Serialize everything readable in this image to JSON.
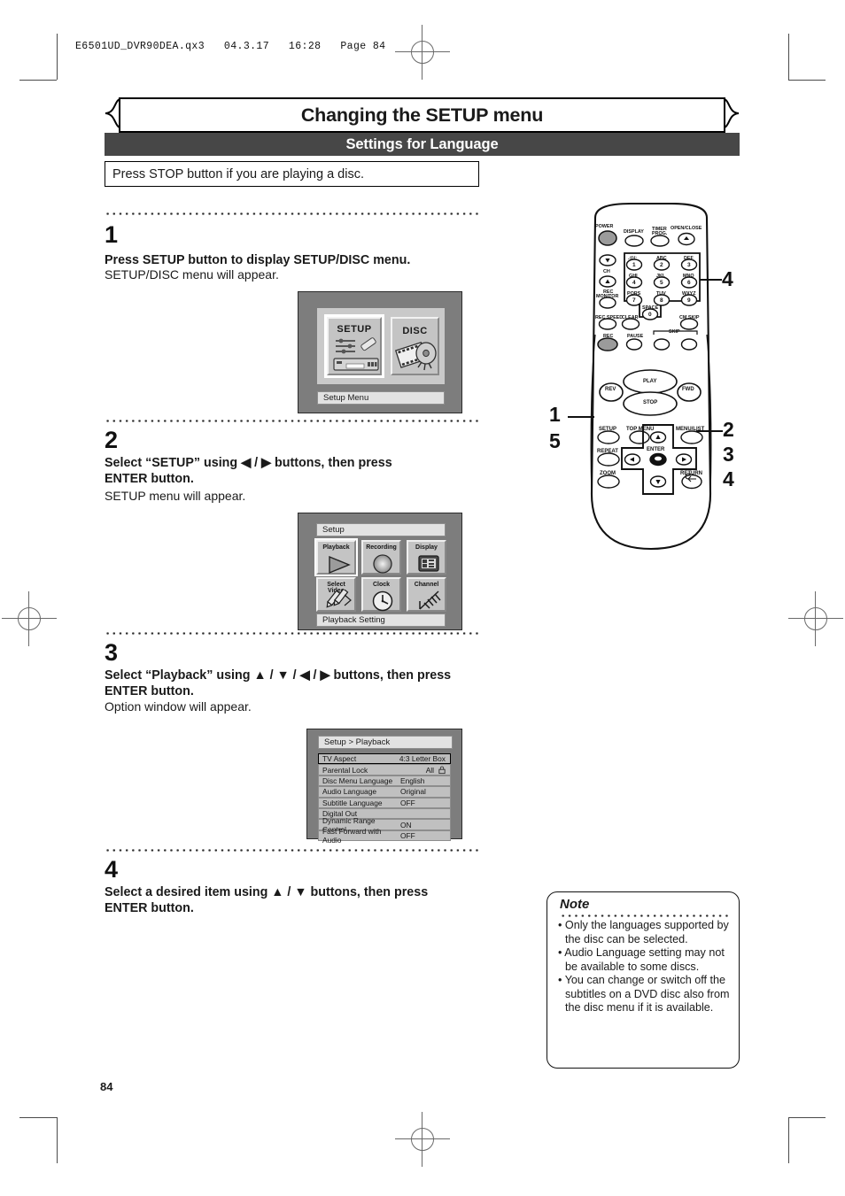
{
  "file_header": "E6501UD_DVR90DEA.qx3   04.3.17   16:28   Page 84",
  "page_number": "84",
  "header": {
    "title": "Changing the SETUP menu",
    "subtitle": "Settings for Language",
    "precaution": "Press STOP button if you are playing a disc."
  },
  "steps": [
    {
      "num": "1",
      "head": "Press SETUP button to display SETUP/DISC menu.",
      "sub": "SETUP/DISC menu will appear."
    },
    {
      "num": "2",
      "head_line1": "Select “SETUP” using ◀ / ▶ buttons, then press",
      "head_line2": "ENTER button.",
      "sub": "SETUP menu will appear."
    },
    {
      "num": "3",
      "head_line1": "Select “Playback” using ▲ / ▼ / ◀ / ▶ buttons, then press",
      "head_line2": "ENTER button.",
      "sub": "Option window will appear."
    },
    {
      "num": "4",
      "head_line1": "Select a desired item using ▲ / ▼ buttons, then press",
      "head_line2": "ENTER button."
    }
  ],
  "screen1": {
    "tiles": [
      {
        "label": "SETUP",
        "selected": true
      },
      {
        "label": "DISC",
        "selected": false
      }
    ],
    "status": "Setup Menu"
  },
  "screen2": {
    "title": "Setup",
    "tiles": [
      {
        "label": "Playback",
        "selected": true
      },
      {
        "label": "Recording",
        "selected": false
      },
      {
        "label": "Display",
        "selected": false
      },
      {
        "label": "Select\nVideo",
        "selected": false
      },
      {
        "label": "Clock",
        "selected": false
      },
      {
        "label": "Channel",
        "selected": false
      }
    ],
    "status": "Playback Setting"
  },
  "screen3": {
    "title": "Setup > Playback",
    "rows": [
      {
        "label": "TV Aspect",
        "value": "4:3 Letter Box",
        "highlight": true
      },
      {
        "label": "Parental Lock",
        "value": "All",
        "icon": "lock-icon"
      },
      {
        "label": "Disc Menu Language",
        "value": "English"
      },
      {
        "label": "Audio Language",
        "value": "Original"
      },
      {
        "label": "Subtitle Language",
        "value": "OFF"
      },
      {
        "label": "Digital Out",
        "value": ""
      },
      {
        "label": "Dynamic Range Control",
        "value": "ON"
      },
      {
        "label": "Fast Forward with Audio",
        "value": "OFF"
      }
    ]
  },
  "note": {
    "title": "Note",
    "items": [
      "Only the languages supported by the disc can be selected.",
      "Audio Language setting may not be available to some discs.",
      "You can change or switch off the subtitles on a DVD disc also from the disc menu if it is available."
    ]
  },
  "remote": {
    "labels": {
      "power": "POWER",
      "display": "DISPLAY",
      "timer_prog_1": "TIMER",
      "timer_prog_2": "PROG.",
      "open_close": "OPEN/CLOSE",
      "ch": "CH",
      "rec_monitor_1": "REC",
      "rec_monitor_2": "MONITOR",
      "rec_speed": "REC SPEED",
      "clear": "CLEAR",
      "space": "SPACE",
      "cm_skip": "CM SKIP",
      "rec": "REC",
      "pause": "PAUSE",
      "skip": "SKIP",
      "play": "PLAY",
      "stop": "STOP",
      "rev": "REV",
      "fwd": "FWD",
      "setup": "SETUP",
      "top_menu": "TOP MENU",
      "menu_list": "MENU/LIST",
      "repeat": "REPEAT",
      "enter": "ENTER",
      "zoom": "ZOOM",
      "return": "RETURN"
    },
    "keypad": [
      {
        "letters": ".@/:",
        "digit": "1"
      },
      {
        "letters": "ABC",
        "digit": "2"
      },
      {
        "letters": "DEF",
        "digit": "3"
      },
      {
        "letters": "GHI",
        "digit": "4"
      },
      {
        "letters": "JKL",
        "digit": "5"
      },
      {
        "letters": "MNO",
        "digit": "6"
      },
      {
        "letters": "PQRS",
        "digit": "7"
      },
      {
        "letters": "TUV",
        "digit": "8"
      },
      {
        "letters": "WXYZ",
        "digit": "9"
      },
      {
        "letters": "",
        "digit": "0"
      }
    ],
    "callouts": {
      "keypad": "4",
      "setup_a": "1",
      "setup_b": "5",
      "pad_a": "2",
      "pad_b": "3",
      "pad_c": "4"
    }
  },
  "colors": {
    "subbar_bg": "#474747",
    "tv_bezel": "#7d7d7d",
    "tv_field": "#c9c9c9",
    "tile": "#c4c4c4",
    "row": "#c0c0c0"
  }
}
